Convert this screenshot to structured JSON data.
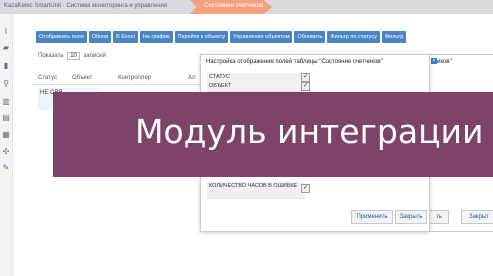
{
  "breadcrumb": {
    "path": "KazaKelec SmartUnit · Система мониторинга и управления",
    "active": "Состояние счетчиков"
  },
  "toolbar": {
    "buttons": [
      "Отображать поля",
      "Обнов",
      "В Excel",
      "На график",
      "Перейти к объекту",
      "Управление объектом",
      "Обновить",
      "Фильтр по статусу",
      "Фильтр"
    ]
  },
  "list": {
    "show_label": "Показать",
    "show_value": "10",
    "records_label": "записей",
    "columns": [
      "Статус",
      "Объект",
      "Контроллер",
      "Ал"
    ],
    "first_row": "НЕ СВЯ"
  },
  "modal": {
    "title": "Настройка отображения полей таблицы \"Состояние счетчиков\"",
    "fields": [
      {
        "label": "СТАТУС",
        "checked": true
      },
      {
        "label": "ОБЪЕКТ",
        "checked": true
      },
      {
        "label": "КОЛИЧЕСТВО ЧАСОВ В ОШИБКЕ",
        "checked": true
      }
    ],
    "apply_label": "Применить",
    "close_label": "Закрыть"
  },
  "modal2": {
    "title": "иков\"",
    "apply_label": "ть",
    "close_label": "Закрыт"
  },
  "banner": {
    "text": "Модуль интеграции",
    "color": "#7d4368"
  },
  "colors": {
    "toolbar_button": "#4a86c5",
    "active_crumb": "#f4a07c"
  }
}
